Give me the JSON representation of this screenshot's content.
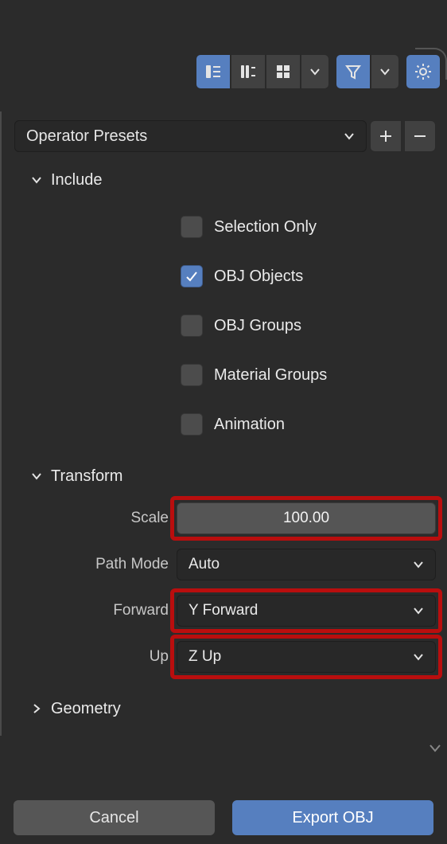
{
  "toolbar": {
    "display_mode_1": "thumbnails-small",
    "display_mode_2": "thumbnails-large",
    "display_mode_3": "grid",
    "filter": "filter",
    "settings": "settings"
  },
  "presets": {
    "label": "Operator Presets"
  },
  "sections": {
    "include": {
      "title": "Include",
      "options": [
        {
          "key": "selection_only",
          "label": "Selection Only",
          "checked": false
        },
        {
          "key": "obj_objects",
          "label": "OBJ Objects",
          "checked": true
        },
        {
          "key": "obj_groups",
          "label": "OBJ Groups",
          "checked": false
        },
        {
          "key": "material_groups",
          "label": "Material Groups",
          "checked": false
        },
        {
          "key": "animation",
          "label": "Animation",
          "checked": false
        }
      ]
    },
    "transform": {
      "title": "Transform",
      "scale_label": "Scale",
      "scale_value": "100.00",
      "pathmode_label": "Path Mode",
      "pathmode_value": "Auto",
      "forward_label": "Forward",
      "forward_value": "Y Forward",
      "up_label": "Up",
      "up_value": "Z Up"
    },
    "geometry": {
      "title": "Geometry"
    }
  },
  "footer": {
    "cancel": "Cancel",
    "export": "Export OBJ"
  }
}
